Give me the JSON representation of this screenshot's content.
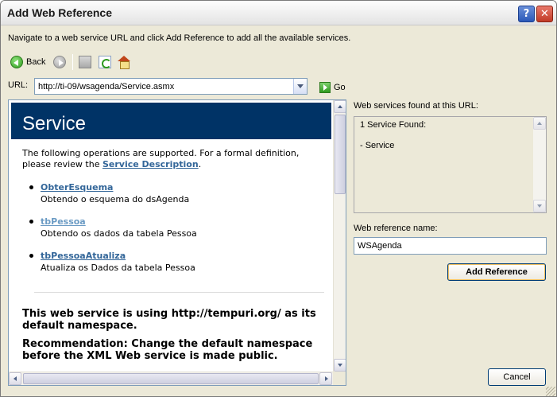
{
  "window": {
    "title": "Add Web Reference"
  },
  "instructions": "Navigate to a web service URL and click Add Reference to add all the available services.",
  "toolbar": {
    "back_label": "Back"
  },
  "url": {
    "label": "URL:",
    "value": "http://ti-09/wsagenda/Service.asmx",
    "go_label": "Go"
  },
  "page": {
    "title": "Service",
    "intro_text": "The following operations are supported. For a formal definition, please review the ",
    "intro_link": "Service Description",
    "intro_end": ".",
    "operations": [
      {
        "name": "ObterEsquema",
        "description": "Obtendo o esquema do dsAgenda"
      },
      {
        "name": "tbPessoa",
        "description": "Obtendo os dados da tabela Pessoa"
      },
      {
        "name": "tbPessoaAtualiza",
        "description": "Atualiza os Dados da tabela Pessoa"
      }
    ],
    "namespace_note": "This web service is using http://tempuri.org/ as its default namespace.",
    "recommendation": "Recommendation: Change the default namespace before the XML Web service is made public."
  },
  "found": {
    "label": "Web services found at this URL:",
    "count_text": "1 Service Found:",
    "service_text": "- Service"
  },
  "reference": {
    "label": "Web reference name:",
    "value": "WSAgenda"
  },
  "buttons": {
    "add_reference": "Add Reference",
    "cancel": "Cancel"
  }
}
